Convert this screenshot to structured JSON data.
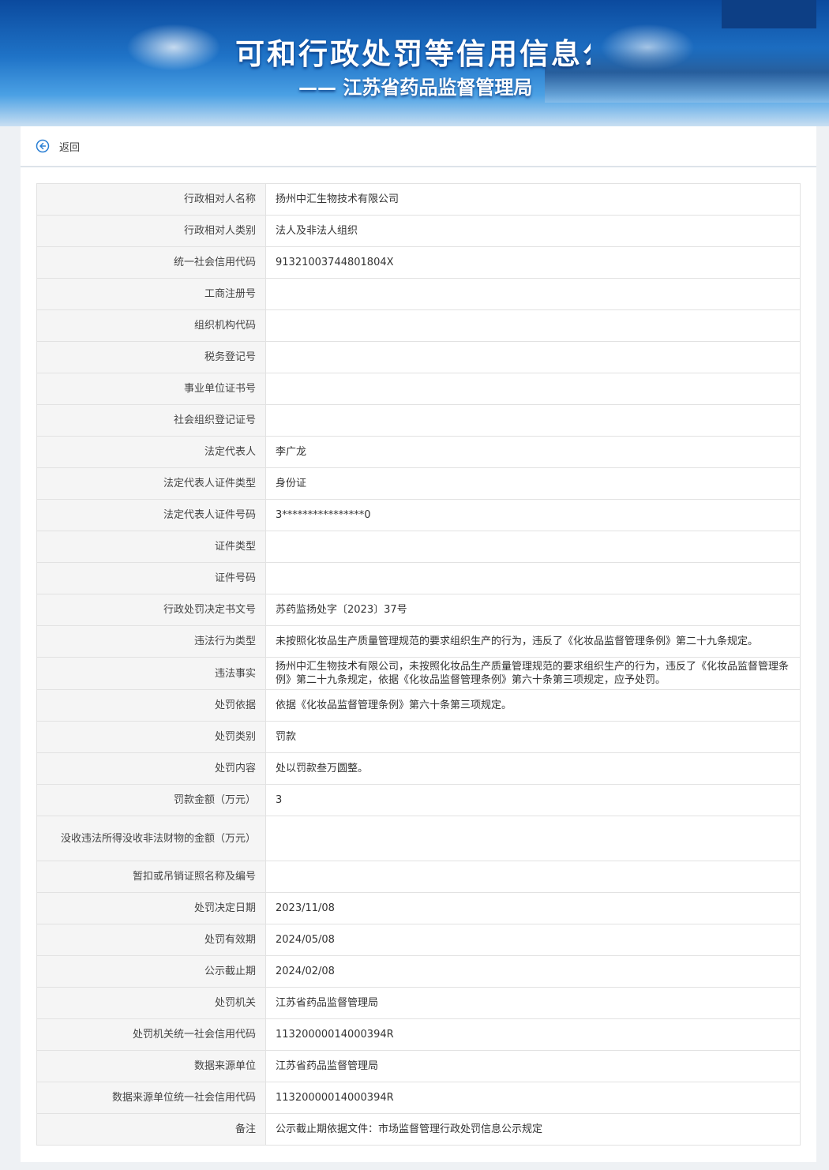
{
  "banner": {
    "title": "可和行政处罚等信用信息公",
    "subtitle": "—— 江苏省药品监督管理局"
  },
  "back": {
    "label": "返回",
    "icon": "arrow-left-circle-icon"
  },
  "colors": {
    "accent": "#2a7fd4",
    "label_bg": "#f5f5f5",
    "border": "#e2e2e2"
  },
  "rows": [
    {
      "label": "行政相对人名称",
      "value": "扬州中汇生物技术有限公司"
    },
    {
      "label": "行政相对人类别",
      "value": "法人及非法人组织"
    },
    {
      "label": "统一社会信用代码",
      "value": "91321003744801804X"
    },
    {
      "label": "工商注册号",
      "value": ""
    },
    {
      "label": "组织机构代码",
      "value": ""
    },
    {
      "label": "税务登记号",
      "value": ""
    },
    {
      "label": "事业单位证书号",
      "value": ""
    },
    {
      "label": "社会组织登记证号",
      "value": ""
    },
    {
      "label": "法定代表人",
      "value": "李广龙"
    },
    {
      "label": "法定代表人证件类型",
      "value": "身份证"
    },
    {
      "label": "法定代表人证件号码",
      "value": "3****************0"
    },
    {
      "label": "证件类型",
      "value": ""
    },
    {
      "label": "证件号码",
      "value": ""
    },
    {
      "label": "行政处罚决定书文号",
      "value": "苏药监扬处字〔2023〕37号"
    },
    {
      "label": "违法行为类型",
      "value": "未按照化妆品生产质量管理规范的要求组织生产的行为，违反了《化妆品监督管理条例》第二十九条规定。"
    },
    {
      "label": "违法事实",
      "value": "扬州中汇生物技术有限公司，未按照化妆品生产质量管理规范的要求组织生产的行为，违反了《化妆品监督管理条例》第二十九条规定，依据《化妆品监督管理条例》第六十条第三项规定，应予处罚。"
    },
    {
      "label": "处罚依据",
      "value": "依据《化妆品监督管理条例》第六十条第三项规定。"
    },
    {
      "label": "处罚类别",
      "value": "罚款"
    },
    {
      "label": "处罚内容",
      "value": "处以罚款叁万圆整。"
    },
    {
      "label": "罚款金额（万元）",
      "value": "3"
    },
    {
      "label": "没收违法所得没收非法财物的金额（万元）",
      "value": ""
    },
    {
      "label": "暂扣或吊销证照名称及编号",
      "value": ""
    },
    {
      "label": "处罚决定日期",
      "value": "2023/11/08"
    },
    {
      "label": "处罚有效期",
      "value": "2024/05/08"
    },
    {
      "label": "公示截止期",
      "value": "2024/02/08"
    },
    {
      "label": "处罚机关",
      "value": "江苏省药品监督管理局"
    },
    {
      "label": "处罚机关统一社会信用代码",
      "value": "11320000014000394R"
    },
    {
      "label": "数据来源单位",
      "value": "江苏省药品监督管理局"
    },
    {
      "label": "数据来源单位统一社会信用代码",
      "value": "11320000014000394R"
    },
    {
      "label": "备注",
      "value": "公示截止期依据文件：市场监督管理行政处罚信息公示规定"
    }
  ]
}
